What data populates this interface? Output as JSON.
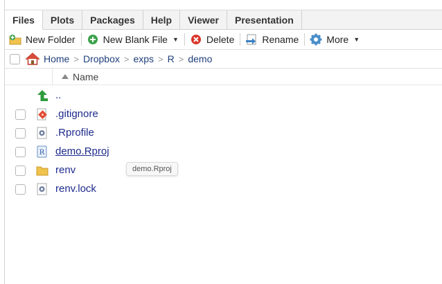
{
  "tabs": [
    {
      "label": "Files",
      "active": true
    },
    {
      "label": "Plots",
      "active": false
    },
    {
      "label": "Packages",
      "active": false
    },
    {
      "label": "Help",
      "active": false
    },
    {
      "label": "Viewer",
      "active": false
    },
    {
      "label": "Presentation",
      "active": false
    }
  ],
  "toolbar": {
    "new_folder": "New Folder",
    "new_blank_file": "New Blank File",
    "delete": "Delete",
    "rename": "Rename",
    "more": "More"
  },
  "breadcrumb": [
    "Home",
    "Dropbox",
    "exps",
    "R",
    "demo"
  ],
  "column_header": {
    "name": "Name"
  },
  "files": [
    {
      "name": "..",
      "icon": "up-arrow-icon"
    },
    {
      "name": ".gitignore",
      "icon": "git-file-icon"
    },
    {
      "name": ".Rprofile",
      "icon": "gear-file-icon"
    },
    {
      "name": "demo.Rproj",
      "icon": "rproj-file-icon",
      "hovered": true
    },
    {
      "name": "renv",
      "icon": "folder-icon"
    },
    {
      "name": "renv.lock",
      "icon": "gear-file-icon"
    }
  ],
  "tooltip": "demo.Rproj",
  "colors": {
    "link": "#1d2a8c",
    "crumb": "#1f3f7a",
    "up_arrow": "#2e9b3c",
    "folder": "#f0c24e",
    "git": "#e24b33",
    "delete_icon": "#d9362b",
    "add_icon": "#3aa14a"
  }
}
